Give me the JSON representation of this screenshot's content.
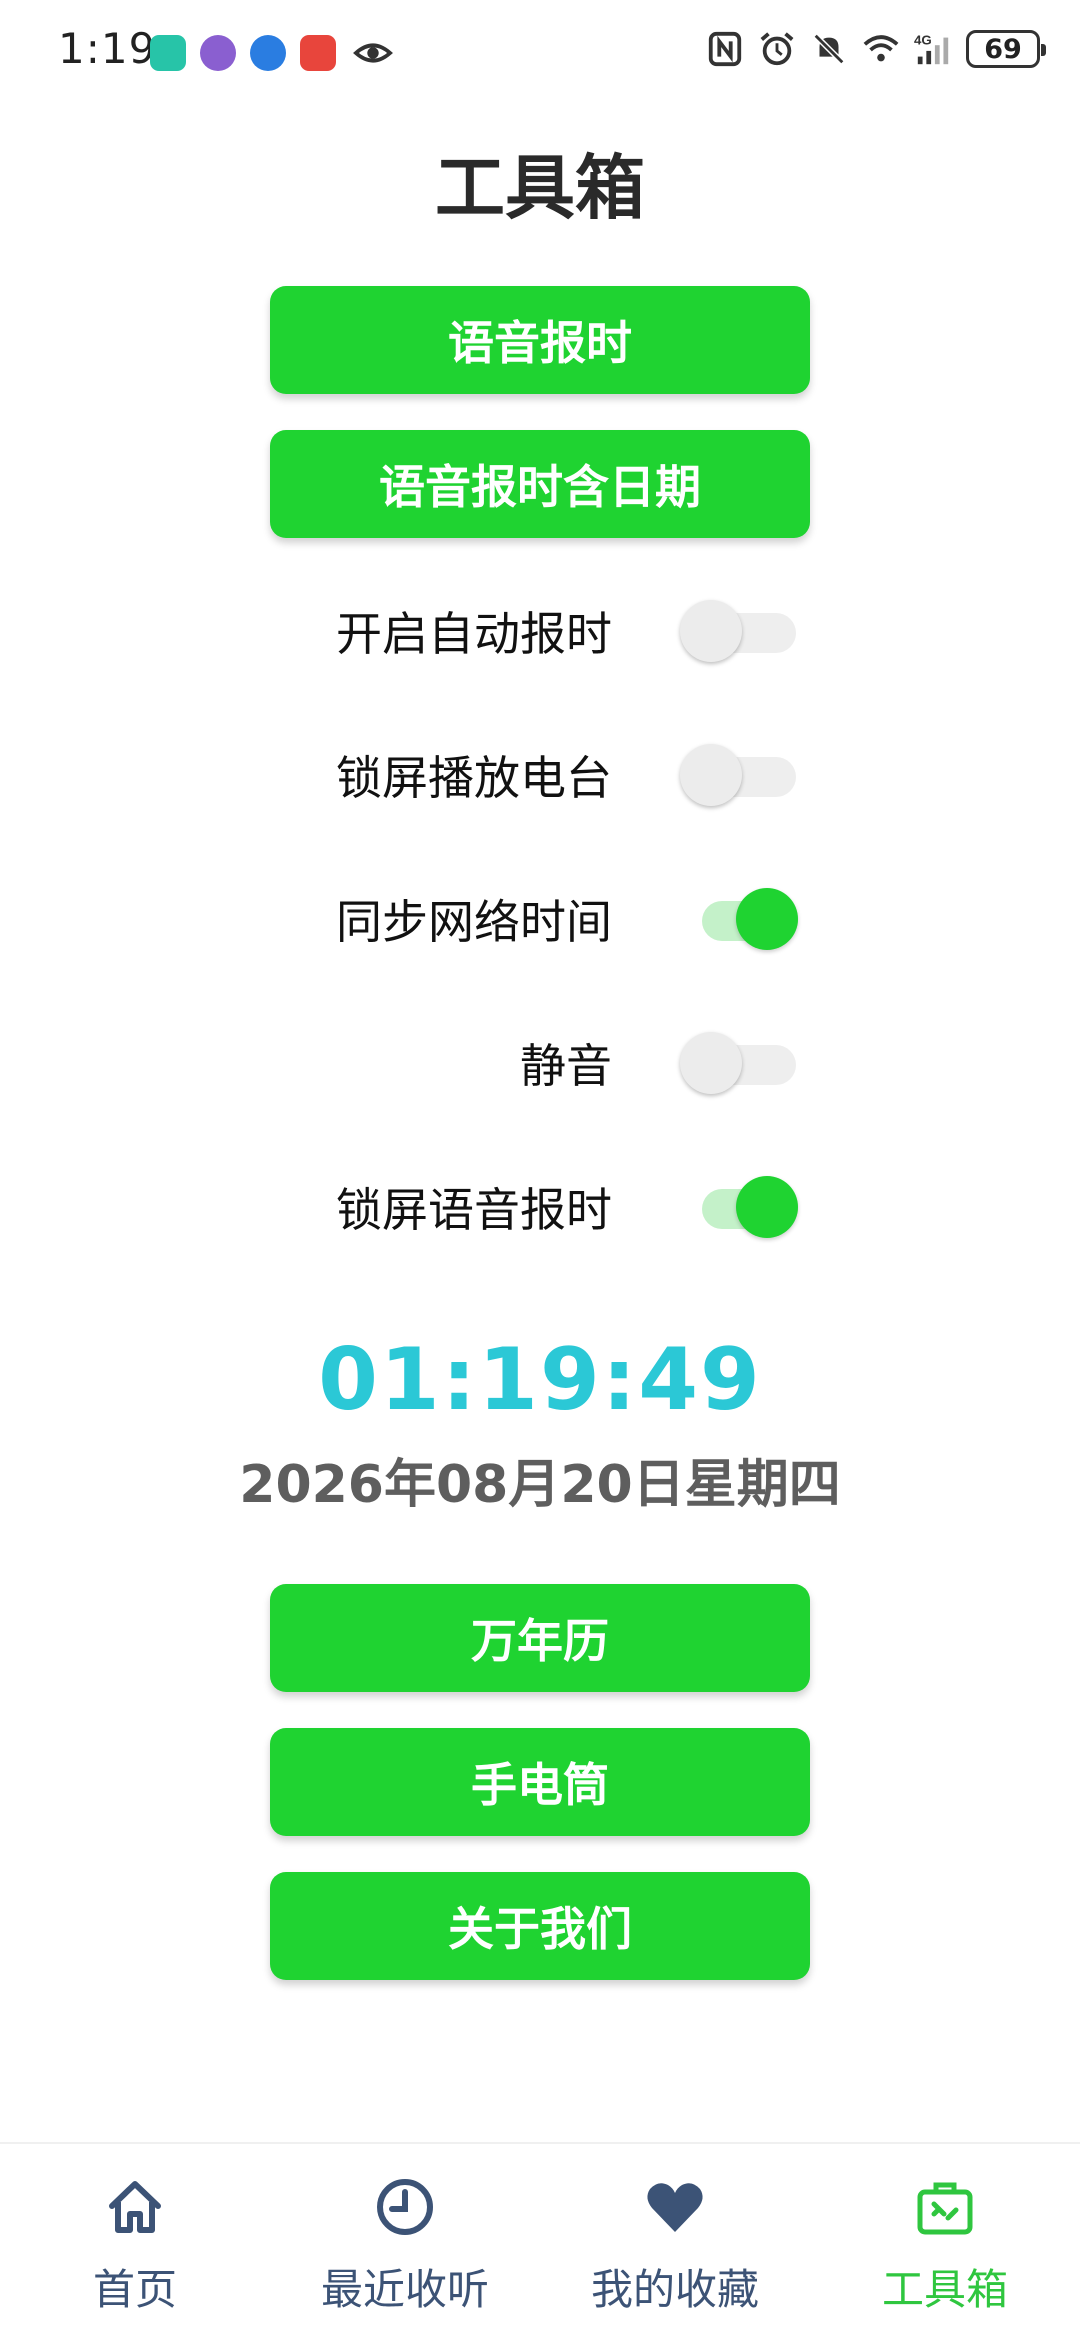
{
  "status_bar": {
    "time": "1:19",
    "battery": "69",
    "network": "4G"
  },
  "header": {
    "title": "工具箱"
  },
  "buttons": {
    "voice_time": "语音报时",
    "voice_time_date": "语音报时含日期",
    "calendar": "万年历",
    "flashlight": "手电筒",
    "about": "关于我们"
  },
  "toggles": [
    {
      "label": "开启自动报时",
      "on": false
    },
    {
      "label": "锁屏播放电台",
      "on": false
    },
    {
      "label": "同步网络时间",
      "on": true
    },
    {
      "label": "静音",
      "on": false
    },
    {
      "label": "锁屏语音报时",
      "on": true
    }
  ],
  "clock": {
    "time": "01:19:49",
    "date": "2026年08月20日星期四"
  },
  "nav": {
    "items": [
      {
        "label": "首页",
        "icon": "home-icon"
      },
      {
        "label": "最近收听",
        "icon": "clock-icon"
      },
      {
        "label": "我的收藏",
        "icon": "heart-icon"
      },
      {
        "label": "工具箱",
        "icon": "toolbox-icon"
      }
    ],
    "active_index": 3
  },
  "colors": {
    "accent_green": "#1fd331",
    "clock_cyan": "#2bc8d6",
    "nav_inactive": "#3c5376",
    "nav_active": "#2fc63f"
  }
}
